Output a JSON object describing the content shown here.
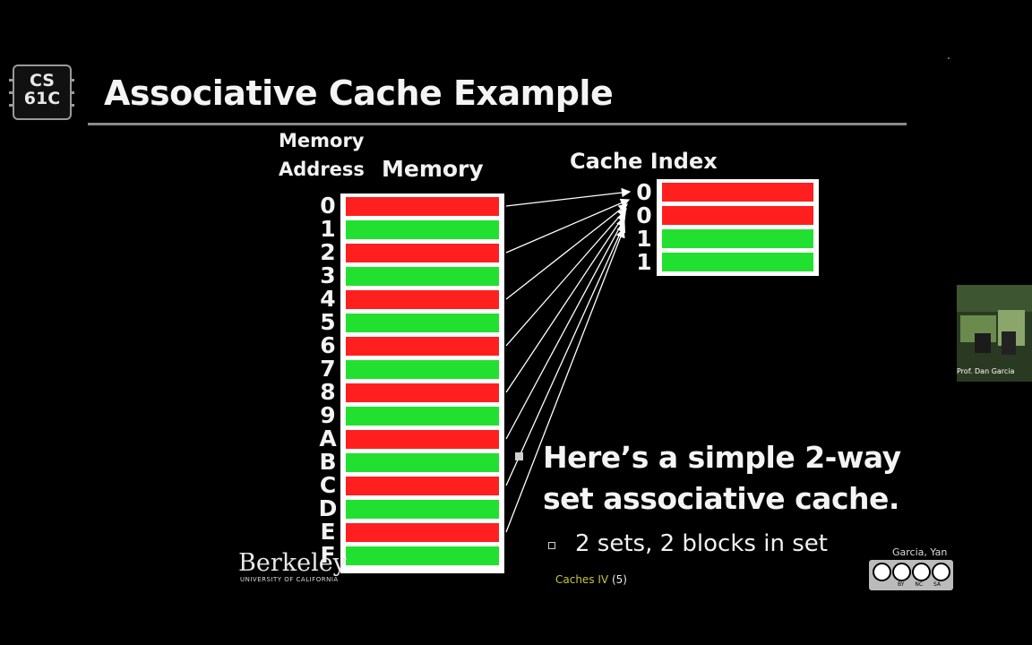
{
  "logo": {
    "line1": "CS",
    "line2": "61C"
  },
  "title": "Associative Cache Example",
  "headers": {
    "memory_address_line1": "Memory",
    "memory_address_line2": "Address",
    "memory": "Memory",
    "cache_index": "Cache Index"
  },
  "colors": {
    "red": "#ff1f1f",
    "green": "#22e030",
    "box": "#ffffff"
  },
  "memory_rows": [
    {
      "address": "0",
      "color": "red"
    },
    {
      "address": "1",
      "color": "green"
    },
    {
      "address": "2",
      "color": "red"
    },
    {
      "address": "3",
      "color": "green"
    },
    {
      "address": "4",
      "color": "red"
    },
    {
      "address": "5",
      "color": "green"
    },
    {
      "address": "6",
      "color": "red"
    },
    {
      "address": "7",
      "color": "green"
    },
    {
      "address": "8",
      "color": "red"
    },
    {
      "address": "9",
      "color": "green"
    },
    {
      "address": "A",
      "color": "red"
    },
    {
      "address": "B",
      "color": "green"
    },
    {
      "address": "C",
      "color": "red"
    },
    {
      "address": "D",
      "color": "green"
    },
    {
      "address": "E",
      "color": "red"
    },
    {
      "address": "F",
      "color": "green"
    }
  ],
  "cache_rows": [
    {
      "index": "0",
      "color": "red"
    },
    {
      "index": "0",
      "color": "red"
    },
    {
      "index": "1",
      "color": "green"
    },
    {
      "index": "1",
      "color": "green"
    }
  ],
  "bullet": "Here’s a simple 2-way set associative cache.",
  "sub_bullet": "2 sets, 2 blocks in set",
  "footer": {
    "institution": "Berkeley",
    "institution_sub": "UNIVERSITY OF CALIFORNIA",
    "topic": "Caches IV",
    "page": "(5)",
    "authors": "Garcia, Yan",
    "license_labels": "BY NC SA"
  },
  "video": {
    "caption": "Prof. Dan Garcia"
  }
}
